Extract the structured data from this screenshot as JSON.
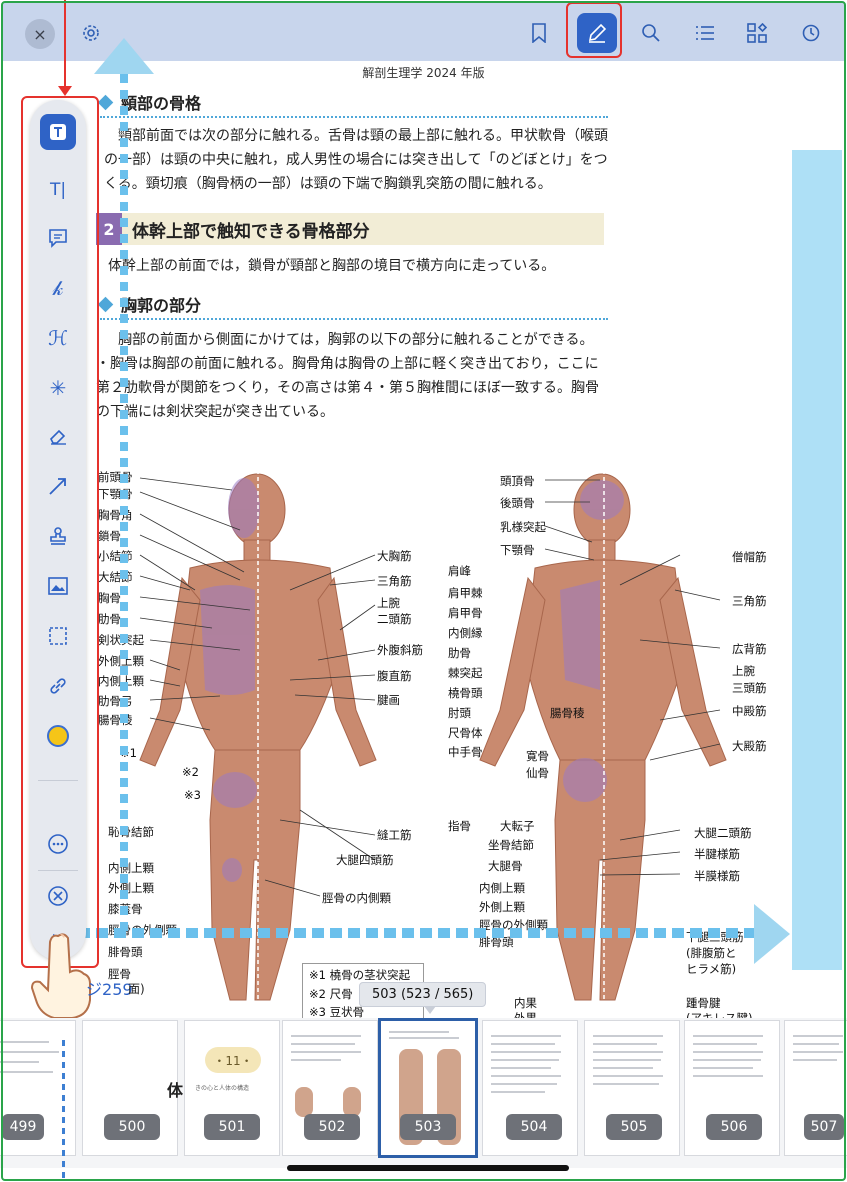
{
  "toolbar": {
    "close_icon": "×",
    "settings_icon": "gear-icon",
    "bookmark_icon": "bookmark-icon",
    "pen_icon": "pen-icon",
    "search_icon": "search-icon",
    "list_icon": "list-icon",
    "grid_icon": "grid-icon",
    "history_icon": "history-icon"
  },
  "header": {
    "title": "解剖生理学 2024 年版"
  },
  "content": {
    "section1_title": "頸部の骨格",
    "section1_text": "頸部前面では次の部分に触れる。舌骨は頸の最上部に触れる。甲状軟骨（喉頭の一部）は頸の中央に触れ，成人男性の場合には突き出して「のどぼとけ」をつくる。頸切痕（胸骨柄の一部）は頸の下端で胸鎖乳突筋の間に触れる。",
    "chapter_num": "2",
    "chapter_title": "体幹上部で触知できる骨格部分",
    "chapter_text": "体幹上部の前面では，鎖骨が頸部と胸部の境目で横方向に走っている。",
    "section2_title": "胸郭の部分",
    "section2_text_1": "胸部の前面から側面にかけては，胸郭の以下の部分に触れることができる。",
    "section2_text_2": "・胸骨は胸部の前面に触れる。胸骨角は胸骨の上部に軽く突き出ており，ここに第２肋軟骨が関節をつくり，その高さは第４・第５胸椎間にほぼ一致する。胸骨の下端には剣状突起が突き出ている。"
  },
  "labels_front_left": [
    "前頭骨",
    "下顎骨",
    "胸骨角",
    "鎖骨",
    "小結節",
    "大結節",
    "胸骨",
    "肋骨",
    "剣状突起",
    "外側上顆",
    "内側上顆",
    "肋骨弓",
    "腸骨稜",
    "※1",
    "※2",
    "※3",
    "恥骨結節",
    "内側上顆",
    "外側上顆",
    "膝蓋骨",
    "脛骨の外側顆",
    "腓骨頭",
    "脛骨"
  ],
  "labels_front_right": [
    "大胸筋",
    "三角筋",
    "上腕",
    "二頭筋",
    "外腹斜筋",
    "腹直筋",
    "腱画",
    "縫工筋",
    "大腿四頭筋",
    "脛骨の内側顆"
  ],
  "labels_back_left": [
    "頭頂骨",
    "後頭骨",
    "乳様突起",
    "下顎骨",
    "肩峰",
    "肩甲棘",
    "肩甲骨",
    "内側縁",
    "肋骨",
    "棘突起",
    "橈骨頭",
    "肘頭",
    "尺骨体",
    "中手骨",
    "腸骨稜",
    "寛骨",
    "仙骨",
    "指骨",
    "大転子",
    "坐骨結節",
    "大腿骨",
    "内側上顆",
    "外側上顆",
    "脛骨の外側顆",
    "腓骨頭",
    "内果",
    "外果"
  ],
  "labels_back_right": [
    "僧帽筋",
    "三角筋",
    "広背筋",
    "上腕",
    "三頭筋",
    "中殿筋",
    "大殿筋",
    "大腿二頭筋",
    "半腱様筋",
    "半膜様筋",
    "下腿三頭筋",
    "(腓腹筋と",
    "ヒラメ筋)",
    "踵骨腱",
    "(アキレス腱)"
  ],
  "footnotes": [
    "※1 橈骨の茎状突起",
    "※2 尺骨",
    "※3 豆状骨"
  ],
  "annotation_tools": [
    "text-box-tool",
    "text-cursor-tool",
    "note-tool",
    "pen-tool",
    "highlighter-tool",
    "magic-pen-tool",
    "eraser-tool",
    "line-tool",
    "stamp-tool",
    "image-tool",
    "selection-tool",
    "link-tool",
    "color-tool",
    "more-tool",
    "close-tool",
    "drag-handle"
  ],
  "page_ref": {
    "number": "259",
    "rest": "面)"
  },
  "tooltip": "503 (523 / 565)",
  "thumbnails": [
    {
      "num": "499"
    },
    {
      "num": "500",
      "big_text": "体"
    },
    {
      "num": "501",
      "badge": "・11・",
      "sub": "きの心と人体の構造"
    },
    {
      "num": "502"
    },
    {
      "num": "503"
    },
    {
      "num": "504"
    },
    {
      "num": "505"
    },
    {
      "num": "506"
    },
    {
      "num": "507"
    }
  ],
  "colors": {
    "toolbar_bg": "#c8d5ec",
    "accent": "#2f63c6",
    "highlight_red": "#e5322d",
    "guide_blue": "#6bc0ec"
  }
}
